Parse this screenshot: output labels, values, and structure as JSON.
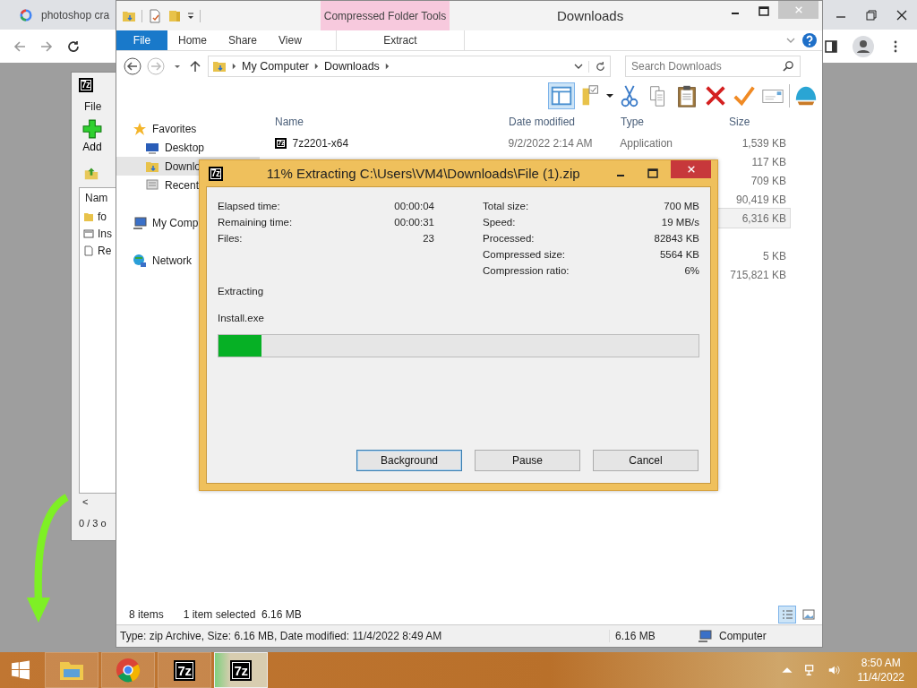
{
  "browser": {
    "tab_title": "photoshop cra"
  },
  "archiver_window": {
    "icon_text": "7z",
    "menu": [
      "File"
    ],
    "add_label": "Add",
    "list_header": "Nam",
    "rows": [
      {
        "kind": "folder",
        "name": "fo"
      },
      {
        "kind": "program",
        "name": "Ins"
      },
      {
        "kind": "text",
        "name": "Re"
      }
    ],
    "scroll_glyph": "<",
    "status": "0 / 3 o"
  },
  "explorer": {
    "title": "Downloads",
    "context_group": "Compressed Folder Tools",
    "tabs": [
      {
        "label": "File",
        "kind": "file"
      },
      {
        "label": "Home",
        "kind": "tab"
      },
      {
        "label": "Share",
        "kind": "tab"
      },
      {
        "label": "View",
        "kind": "tab"
      },
      {
        "label": "Extract",
        "kind": "context"
      }
    ],
    "address": [
      "My Computer",
      "Downloads"
    ],
    "search": {
      "placeholder": "Search Downloads"
    },
    "nav": [
      {
        "label": "Favorites",
        "kind": "group",
        "selected": false
      },
      {
        "label": "Desktop",
        "kind": "item",
        "selected": false
      },
      {
        "label": "Downlo",
        "kind": "item",
        "selected": true
      },
      {
        "label": "Recent",
        "kind": "item",
        "selected": false
      },
      {
        "label": "My Comp",
        "kind": "group",
        "selected": false
      },
      {
        "label": "Network",
        "kind": "group",
        "selected": false
      }
    ],
    "columns": [
      "Name",
      "Date modified",
      "Type",
      "Size"
    ],
    "rows": [
      {
        "icon_text": "7z",
        "name": "7z2201-x64",
        "date": "9/2/2022 2:14 AM",
        "type": "Application",
        "size": "1,539 KB",
        "selected": false
      },
      {
        "size": "117 KB",
        "selected": false
      },
      {
        "size": "709 KB",
        "selected": false
      },
      {
        "size": "90,419 KB",
        "selected": false
      },
      {
        "size": "6,316 KB",
        "selected": true
      },
      {
        "selected": false
      },
      {
        "size": "5 KB",
        "selected": false
      },
      {
        "size": "715,821 KB",
        "selected": false
      }
    ],
    "status": {
      "count": "8 items",
      "selection": "1 item selected  6.16 MB"
    },
    "details": {
      "text": "Type: zip Archive, Size: 6.16 MB, Date modified: 11/4/2022 8:49 AM",
      "size": "6.16 MB",
      "location": "Computer"
    }
  },
  "dialog": {
    "icon_text": "7z",
    "title": "11% Extracting C:\\Users\\VM4\\Downloads\\File (1).zip",
    "left_stats": [
      {
        "label": "Elapsed time:",
        "value": "00:00:04"
      },
      {
        "label": "Remaining time:",
        "value": "00:00:31"
      },
      {
        "label": "Files:",
        "value": "23"
      }
    ],
    "right_stats": [
      {
        "label": "Total size:",
        "value": "700 MB"
      },
      {
        "label": "Speed:",
        "value": "19 MB/s"
      },
      {
        "label": "Processed:",
        "value": "82843 KB"
      },
      {
        "label": "Compressed size:",
        "value": "5564 KB"
      },
      {
        "label": "Compression ratio:",
        "value": "6%"
      }
    ],
    "operation": "Extracting",
    "current_file": "Install.exe",
    "progress": {
      "level": 0.09
    },
    "buttons": [
      {
        "label": "Background",
        "default": true
      },
      {
        "label": "Pause",
        "default": false
      },
      {
        "label": "Cancel",
        "default": false
      }
    ]
  },
  "taskbar": {
    "items": [
      {
        "kind": "explorer",
        "selected": false
      },
      {
        "kind": "chrome",
        "selected": false
      },
      {
        "kind": "archiver",
        "icon_text": "7z",
        "selected": false
      },
      {
        "kind": "archiver",
        "icon_text": "7z",
        "selected": true
      }
    ],
    "time": "8:50 AM",
    "date": "11/4/2022"
  }
}
